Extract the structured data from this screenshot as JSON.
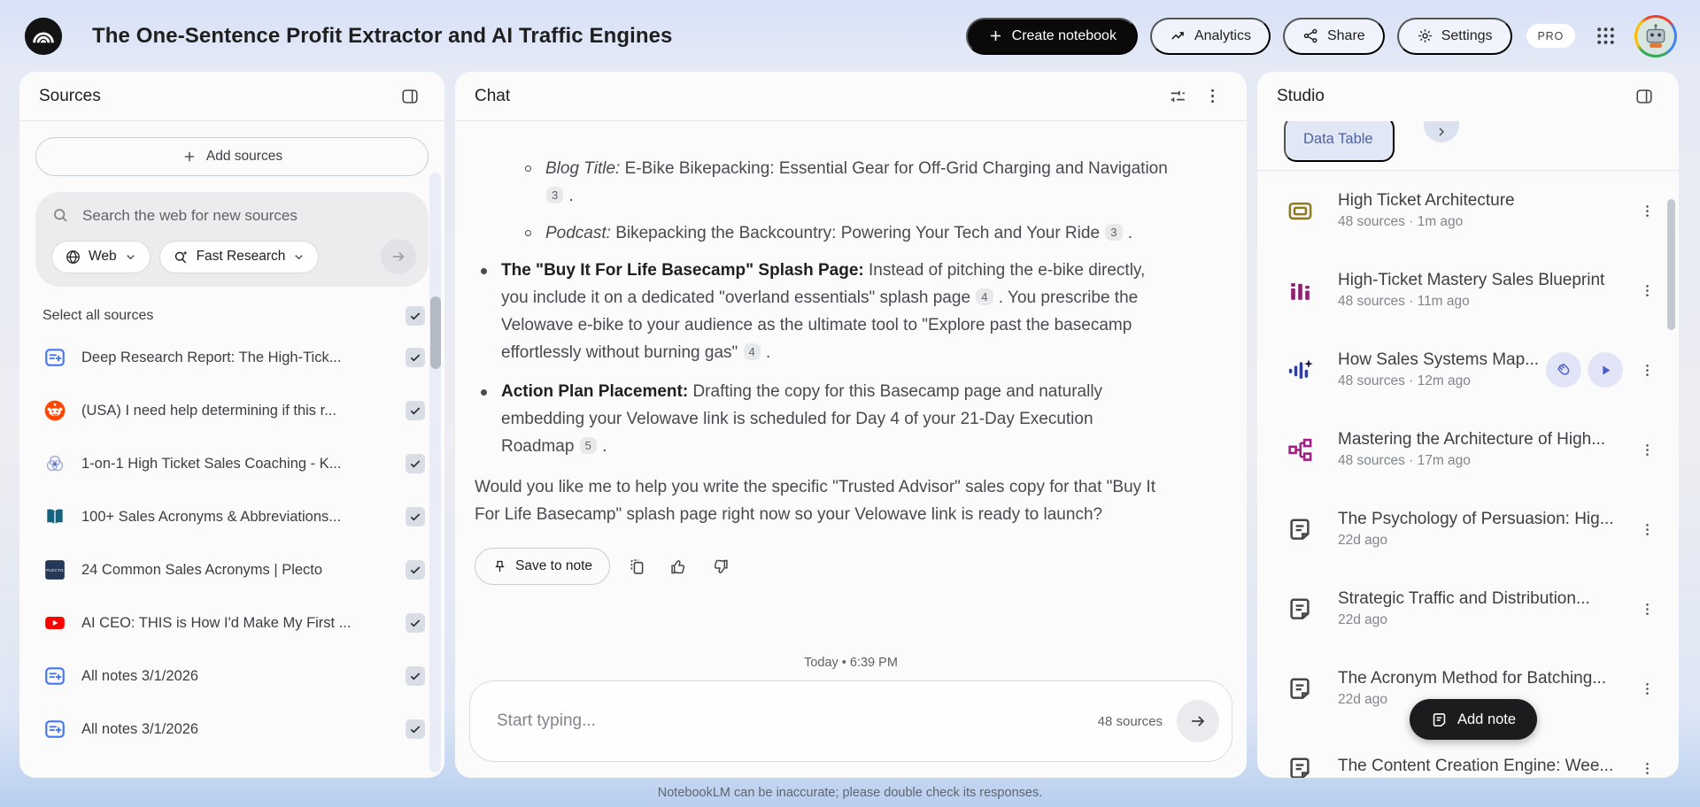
{
  "header": {
    "title": "The One-Sentence Profit Extractor and AI Traffic Engines",
    "create_notebook_label": "Create notebook",
    "analytics_label": "Analytics",
    "share_label": "Share",
    "settings_label": "Settings",
    "pro_badge": "PRO"
  },
  "sources_panel": {
    "title": "Sources",
    "add_sources_label": "Add sources",
    "search_placeholder": "Search the web for new sources",
    "web_chip_label": "Web",
    "research_chip_label": "Fast Research",
    "select_all_label": "Select all sources",
    "items": [
      {
        "title": "Deep Research Report: The High-Tick...",
        "icon": "note-blue",
        "checked": true
      },
      {
        "title": "(USA) I need help determining if this r...",
        "icon": "reddit",
        "checked": true
      },
      {
        "title": "1-on-1 High Ticket Sales Coaching - K...",
        "icon": "venn",
        "checked": true
      },
      {
        "title": "100+ Sales Acronyms & Abbreviations...",
        "icon": "book",
        "checked": true
      },
      {
        "title": "24 Common Sales Acronyms | Plecto",
        "icon": "plecto",
        "checked": true
      },
      {
        "title": "AI CEO: THIS is How I'd Make My First ...",
        "icon": "youtube",
        "checked": true
      },
      {
        "title": "All notes 3/1/2026",
        "icon": "note-blue",
        "checked": true
      },
      {
        "title": "All notes 3/1/2026",
        "icon": "note-blue",
        "checked": true
      }
    ]
  },
  "chat_panel": {
    "title": "Chat",
    "blocks": [
      {
        "type": "sub",
        "segments": [
          {
            "s": "i",
            "t": "Blog Title:"
          },
          {
            "s": "n",
            "t": " E-Bike Bikepacking: Essential Gear for Off-Grid Charging and Navigation "
          },
          {
            "s": "c",
            "t": "3"
          },
          {
            "s": "n",
            "t": " ."
          }
        ]
      },
      {
        "type": "sub",
        "segments": [
          {
            "s": "i",
            "t": "Podcast:"
          },
          {
            "s": "n",
            "t": " Bikepacking the Backcountry: Powering Your Tech and Your Ride "
          },
          {
            "s": "c",
            "t": "3"
          },
          {
            "s": "n",
            "t": " ."
          }
        ]
      },
      {
        "type": "main",
        "segments": [
          {
            "s": "b",
            "t": "The \"Buy It For Life Basecamp\" Splash Page: "
          },
          {
            "s": "n",
            "t": "Instead of pitching the e-bike directly, you include it on a dedicated \"overland essentials\" splash page "
          },
          {
            "s": "c",
            "t": "4"
          },
          {
            "s": "n",
            "t": " . You prescribe the Velowave e-bike to your audience as the ultimate tool to \"Explore past the basecamp effortlessly without burning gas\" "
          },
          {
            "s": "c",
            "t": "4"
          },
          {
            "s": "n",
            "t": " ."
          }
        ]
      },
      {
        "type": "main",
        "segments": [
          {
            "s": "b",
            "t": "Action Plan Placement: "
          },
          {
            "s": "n",
            "t": "Drafting the copy for this Basecamp page and naturally embedding your Velowave link is scheduled for Day 4 of your 21-Day Execution Roadmap "
          },
          {
            "s": "c",
            "t": "5"
          },
          {
            "s": "n",
            "t": " ."
          }
        ]
      },
      {
        "type": "para",
        "segments": [
          {
            "s": "n",
            "t": "Would you like me to help you write the specific \"Trusted Advisor\" sales copy for that \"Buy It For Life Basecamp\" splash page right now so your Velowave link is ready to launch?"
          }
        ]
      }
    ],
    "save_to_note_label": "Save to note",
    "timestamp": "Today • 6:39 PM",
    "input_placeholder": "Start typing...",
    "sources_count": "48 sources",
    "disclaimer": "NotebookLM can be inaccurate; please double check its responses."
  },
  "studio_panel": {
    "title": "Studio",
    "chip_label": "Data Table",
    "add_note_label": "Add note",
    "items": [
      {
        "title": "High Ticket Architecture",
        "meta": "48 sources · 1m ago",
        "icon": "table-gold"
      },
      {
        "title": "High-Ticket Mastery Sales Blueprint",
        "meta": "48 sources · 11m ago",
        "icon": "bars-purple"
      },
      {
        "title": "How Sales Systems Map...",
        "meta": "48 sources · 12m ago",
        "icon": "audio-blue",
        "has_actions": true
      },
      {
        "title": "Mastering the Architecture of High...",
        "meta": "48 sources · 17m ago",
        "icon": "flow-magenta"
      },
      {
        "title": "The Psychology of Persuasion: Hig...",
        "meta": "22d ago",
        "icon": "note-dark"
      },
      {
        "title": "Strategic Traffic and Distribution...",
        "meta": "22d ago",
        "icon": "note-dark"
      },
      {
        "title": "The Acronym Method for Batching...",
        "meta": "22d ago",
        "icon": "note-dark"
      },
      {
        "title": "The Content Creation Engine: Wee...",
        "meta": "",
        "icon": "note-dark"
      }
    ]
  }
}
